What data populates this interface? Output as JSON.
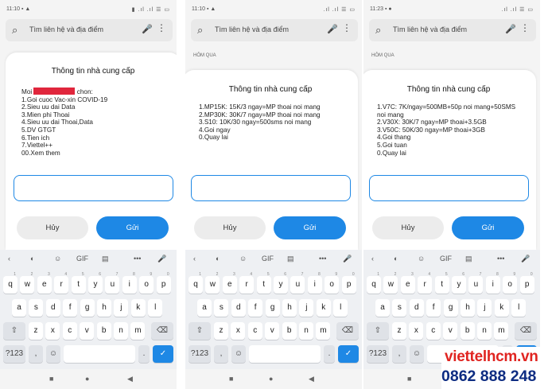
{
  "phones": [
    {
      "status": {
        "time": "11:10",
        "extra": "▪ ▲",
        "icons": "▮ .ıl .ıl ☰ ▭"
      },
      "search": {
        "placeholder": "Tìm liên hệ và địa điểm"
      },
      "section_label": "",
      "dialog": {
        "title": "Thông tin nhà cung cấp",
        "greeting_prefix": "Moi",
        "greeting_suffix": "chon:",
        "lines": [
          "1.Goi cuoc Vac-xin COVID-19",
          "2.Sieu uu dai Data",
          "3.Mien phi Thoai",
          "4.Sieu uu dai Thoai,Data",
          "5.DV GTGT",
          "6.Tien ich",
          "7.Viettel++",
          "00.Xem them"
        ],
        "input_value": "",
        "cancel_label": "Hủy",
        "send_label": "Gửi"
      }
    },
    {
      "status": {
        "time": "11:10",
        "extra": "▪ ▲",
        "icons": ".ıl .ıl ☰ ▭"
      },
      "search": {
        "placeholder": "Tìm liên hệ và địa điểm"
      },
      "section_label": "HÔM QUA",
      "dialog": {
        "title": "Thông tin nhà cung cấp",
        "lines": [
          "1.MP15K: 15K/3 ngay=MP thoai noi mang",
          "2.MP30K: 30K/7 ngay=MP thoai noi mang",
          "3.S10: 10K/30 ngay=500sms noi mang",
          "4.Goi ngay",
          "0.Quay lai"
        ],
        "input_value": "",
        "cancel_label": "Hủy",
        "send_label": "Gửi"
      }
    },
    {
      "status": {
        "time": "11:23",
        "extra": "▪ ●",
        "icons": ".ıl .ıl ☰ ▭"
      },
      "search": {
        "placeholder": "Tìm liên hệ và địa điểm"
      },
      "section_label": "HÔM QUA",
      "dialog": {
        "title": "Thông tin nhà cung cấp",
        "lines": [
          "1.V7C: 7K/ngay=500MB+50p noi mang+50SMS noi mang",
          "2.V30X: 30K/7 ngay=MP thoai+3.5GB",
          "3.V50C: 50K/30 ngay=MP thoai+3GB",
          "4.Goi thang",
          "5.Goi tuan",
          "0.Quay lai"
        ],
        "input_value": "",
        "cancel_label": "Hủy",
        "send_label": "Gửi"
      }
    }
  ],
  "keyboard": {
    "toolbar": {
      "back": "‹",
      "palette": "◐",
      "sticker": "☺",
      "gif": "GIF",
      "clipboard": "▤",
      "more": "•••",
      "mic": "🎤"
    },
    "row1": [
      "q",
      "w",
      "e",
      "r",
      "t",
      "y",
      "u",
      "i",
      "o",
      "p"
    ],
    "row1_nums": [
      "1",
      "2",
      "3",
      "4",
      "5",
      "6",
      "7",
      "8",
      "9",
      "0"
    ],
    "row2": [
      "a",
      "s",
      "d",
      "f",
      "g",
      "h",
      "j",
      "k",
      "l"
    ],
    "row3": [
      "z",
      "x",
      "c",
      "v",
      "b",
      "n",
      "m"
    ],
    "shift": "⇧",
    "backspace": "⌫",
    "symbols": "?123",
    "comma": ",",
    "emoji": "☺",
    "period": ".",
    "enter": "✓"
  },
  "navbar": {
    "recents": "■",
    "home": "●",
    "back": "◀"
  },
  "brand": {
    "site": "viettelhcm.vn",
    "phone": "0862 888 248"
  },
  "colors": {
    "accent": "#1e88e5",
    "redact": "#e0263c",
    "brand_red": "#e02420",
    "brand_navy": "#0d2c82"
  }
}
